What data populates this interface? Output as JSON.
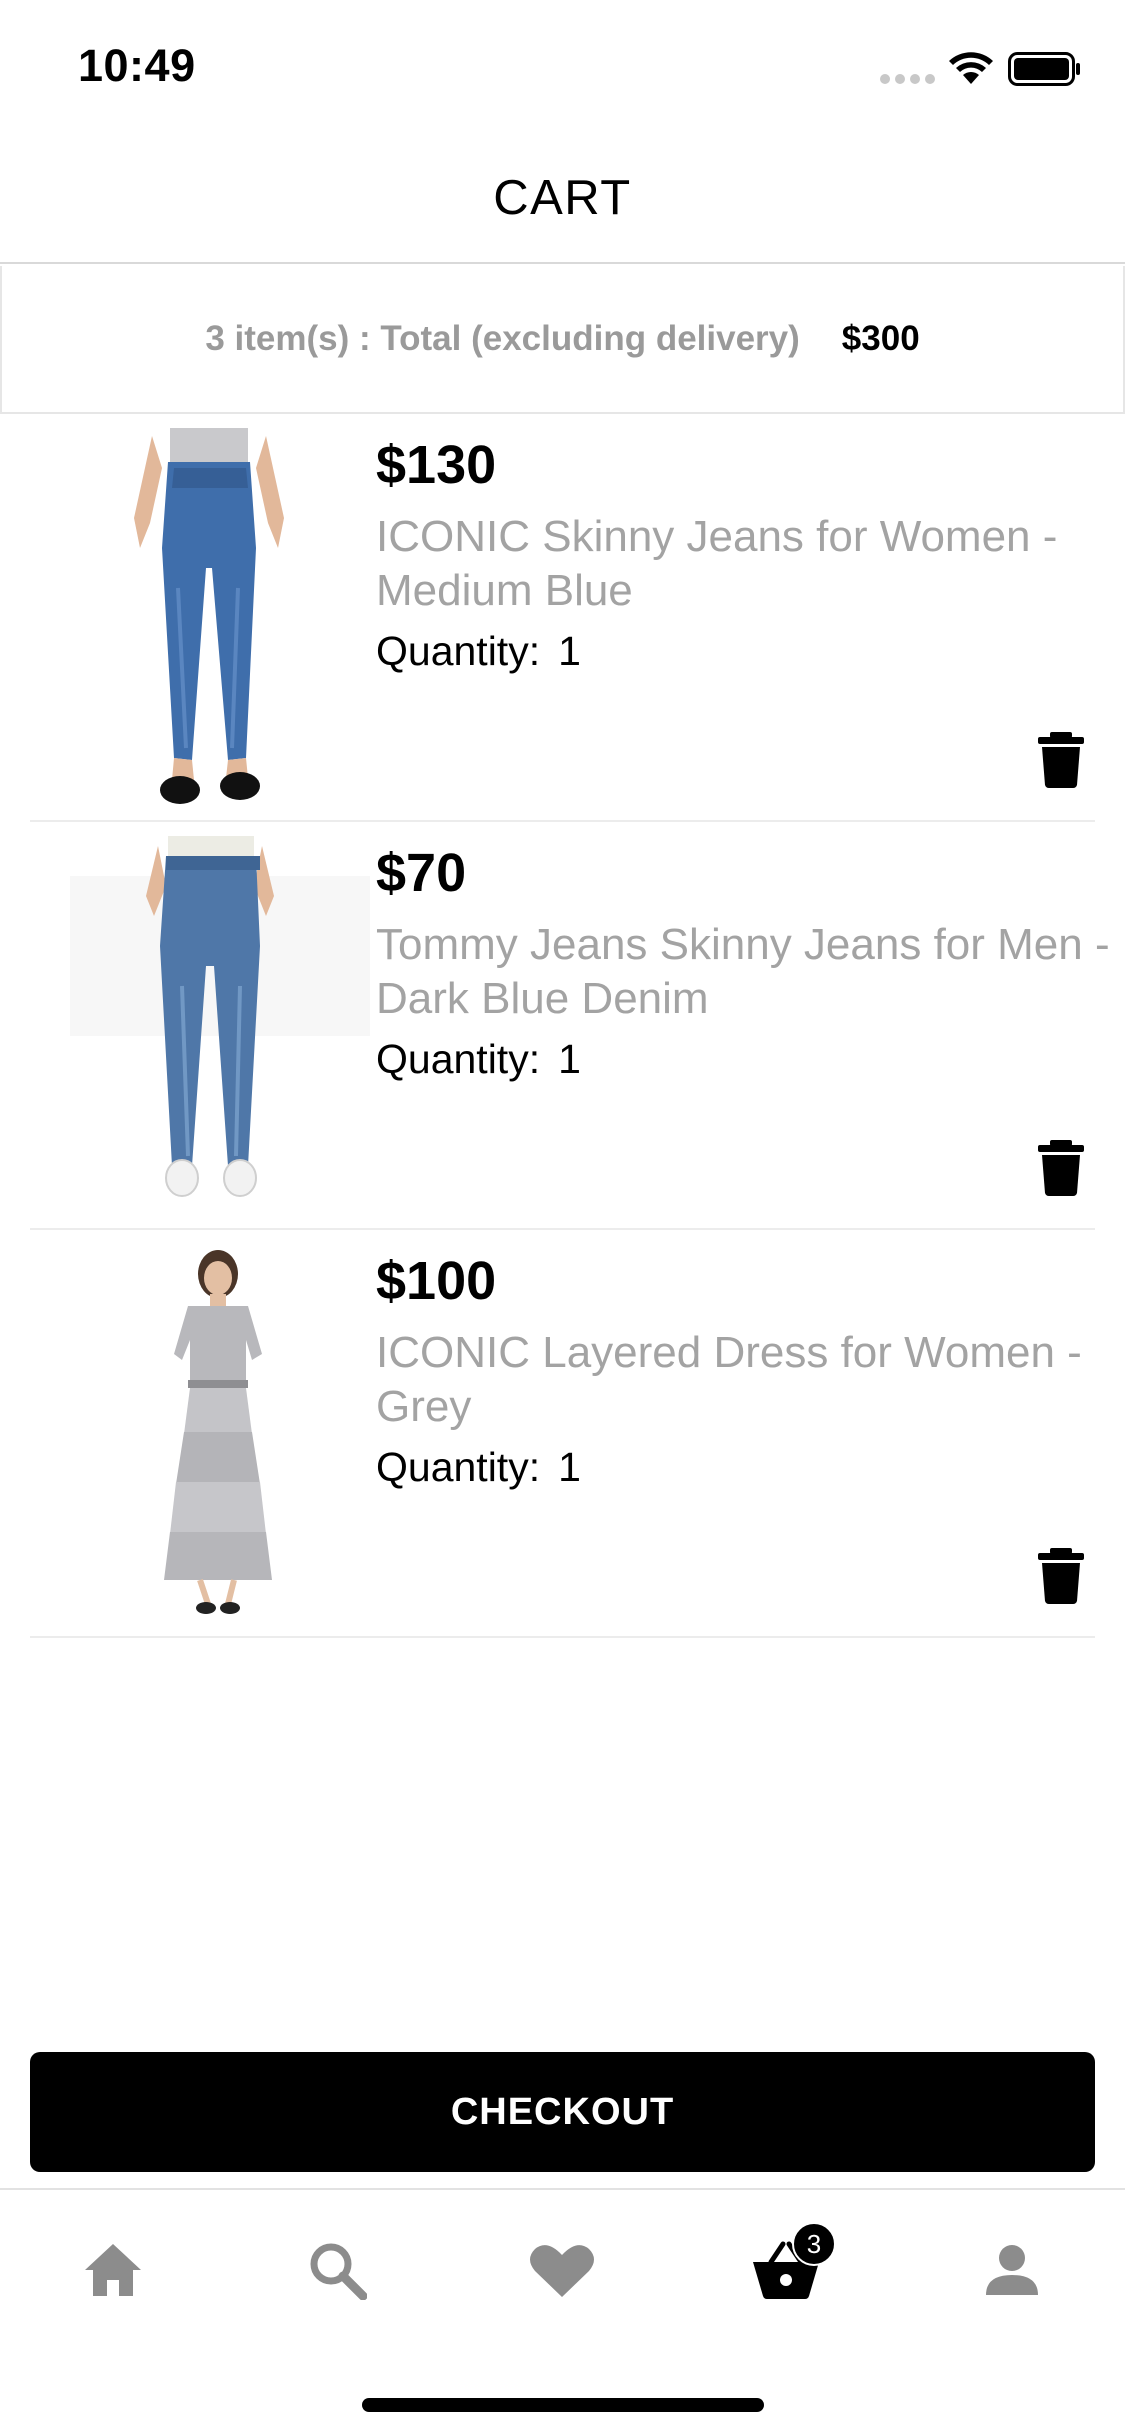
{
  "status_bar": {
    "time": "10:49",
    "icons": [
      "signal-dots-icon",
      "wifi-icon",
      "battery-icon"
    ]
  },
  "header": {
    "title": "CART"
  },
  "summary": {
    "label": "3 item(s) : Total (excluding delivery)",
    "total": "$300"
  },
  "items": [
    {
      "price": "$130",
      "name": "ICONIC Skinny Jeans for Women - Medium Blue",
      "quantity_label": "Quantity:",
      "quantity": "1",
      "image": "model-skinny-jeans-women",
      "delete_icon": "trash-icon"
    },
    {
      "price": "$70",
      "name": "Tommy Jeans Skinny Jeans for Men - Dark Blue Denim",
      "quantity_label": "Quantity:",
      "quantity": "1",
      "image": "model-skinny-jeans-men",
      "delete_icon": "trash-icon"
    },
    {
      "price": "$100",
      "name": "ICONIC Layered Dress for Women - Grey",
      "quantity_label": "Quantity:",
      "quantity": "1",
      "image": "model-layered-dress-grey",
      "delete_icon": "trash-icon"
    }
  ],
  "checkout": {
    "label": "CHECKOUT"
  },
  "tab_bar": {
    "tabs": [
      {
        "name": "home",
        "icon": "home-icon",
        "active": false
      },
      {
        "name": "search",
        "icon": "search-icon",
        "active": false
      },
      {
        "name": "favorites",
        "icon": "heart-icon",
        "active": false
      },
      {
        "name": "cart",
        "icon": "basket-icon",
        "active": true,
        "badge": "3"
      },
      {
        "name": "profile",
        "icon": "user-icon",
        "active": false
      }
    ]
  },
  "colors": {
    "background": "#ffffff",
    "text_primary": "#000000",
    "text_secondary": "#a3a3a3",
    "tab_inactive": "#8c8c8c",
    "divider": "#e6e6e6",
    "checkout_bg": "#000000"
  }
}
